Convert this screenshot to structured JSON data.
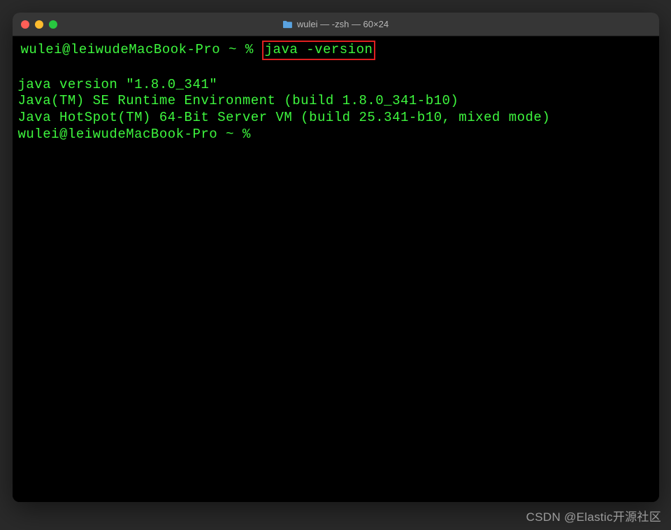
{
  "titlebar": {
    "title": "wulei — -zsh — 60×24",
    "folder_icon": "folder-icon"
  },
  "terminal": {
    "lines": [
      {
        "prompt": "wulei@leiwudeMacBook-Pro ~ % ",
        "command": "java -version",
        "highlighted": true
      },
      {
        "text": "java version \"1.8.0_341\""
      },
      {
        "text": "Java(TM) SE Runtime Environment (build 1.8.0_341-b10)"
      },
      {
        "text": "Java HotSpot(TM) 64-Bit Server VM (build 25.341-b10, mixed mode)"
      },
      {
        "prompt": "wulei@leiwudeMacBook-Pro ~ % ",
        "command": ""
      }
    ]
  },
  "watermark": "CSDN @Elastic开源社区"
}
